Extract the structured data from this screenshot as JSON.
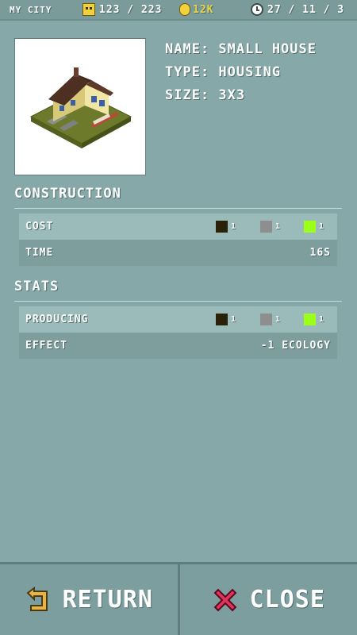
{
  "topbar": {
    "city": "MY CITY",
    "population": "123 / 223",
    "money": "12K",
    "date": "27 / 11 / 3",
    "icons": [
      "face-icon",
      "coin-icon",
      "clock-icon"
    ]
  },
  "building": {
    "name": "NAME: SMALL HOUSE",
    "type": "TYPE: HOUSING",
    "size": "SIZE: 3X3"
  },
  "construction": {
    "title": "CONSTRUCTION",
    "cost_label": "COST",
    "cost_values": [
      "1",
      "1",
      "1"
    ],
    "time_label": "TIME",
    "time_value": "16S"
  },
  "stats": {
    "title": "STATS",
    "producing_label": "PRODUCING",
    "producing_values": [
      "1",
      "1",
      "1"
    ],
    "effect_label": "EFFECT",
    "effect_value": "-1 ECOLOGY"
  },
  "resource_colors": [
    "#2a2208",
    "#8e8e8e",
    "#9cff1a"
  ],
  "buttons": {
    "return_label": "RETURN",
    "close_label": "CLOSE"
  }
}
